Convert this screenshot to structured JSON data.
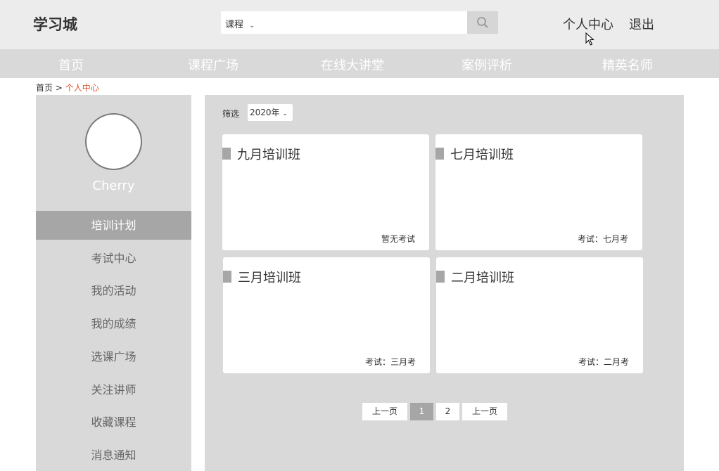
{
  "header": {
    "logo": "学习城",
    "search": {
      "type": "课程",
      "value": "",
      "placeholder": ""
    },
    "user_center": "个人中心",
    "logout": "退出"
  },
  "nav": [
    "首页",
    "课程广场",
    "在线大讲堂",
    "案例评析",
    "精英名师"
  ],
  "breadcrumb": {
    "home": "首页",
    "separator": " > ",
    "current": "个人中心"
  },
  "sidebar": {
    "username": "Cherry",
    "items": [
      "培训计划",
      "考试中心",
      "我的活动",
      "我的成绩",
      "选课广场",
      "关注讲师",
      "收藏课程",
      "消息通知"
    ],
    "active_index": 0
  },
  "main": {
    "filter_label": "筛选",
    "filter_value": "2020年",
    "cards": [
      {
        "title": "九月培训班",
        "status": "暂无考试"
      },
      {
        "title": "七月培训班",
        "status": "考试：七月考"
      },
      {
        "title": "三月培训班",
        "status": "考试：三月考"
      },
      {
        "title": "二月培训班",
        "status": "考试：二月考"
      }
    ],
    "pagination": {
      "prev": "上一页",
      "pages": [
        "1",
        "2"
      ],
      "current": "1",
      "next": "上一页"
    }
  },
  "colors": {
    "header_bg": "#ececec",
    "nav_bg": "#d9d9d9",
    "active": "#a6a6a6",
    "breadcrumb_current": "#e0552b"
  }
}
